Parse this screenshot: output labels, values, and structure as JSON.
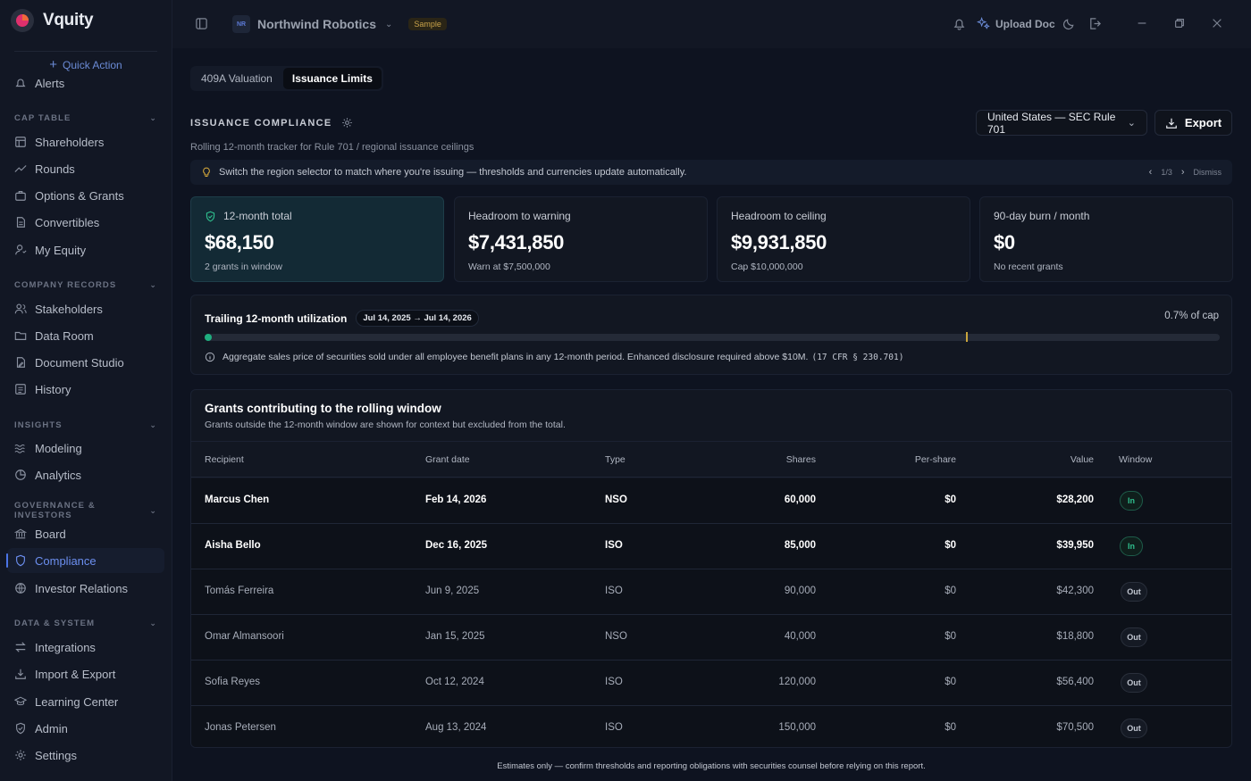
{
  "app": {
    "name": "Vquity",
    "quick_action": "Quick Action"
  },
  "sidebar": {
    "alerts_label": "Alerts",
    "sections": [
      {
        "title": "CAP TABLE",
        "items": [
          "Shareholders",
          "Rounds",
          "Options & Grants",
          "Convertibles",
          "My Equity"
        ]
      },
      {
        "title": "COMPANY RECORDS",
        "items": [
          "Stakeholders",
          "Data Room",
          "Document Studio",
          "History"
        ]
      },
      {
        "title": "INSIGHTS",
        "items": [
          "Modeling",
          "Analytics"
        ]
      },
      {
        "title": "GOVERNANCE & INVESTORS",
        "items": [
          "Board",
          "Compliance",
          "Investor Relations"
        ]
      },
      {
        "title": "DATA & SYSTEM",
        "items": [
          "Integrations",
          "Import & Export",
          "Learning Center",
          "Admin",
          "Settings"
        ]
      }
    ],
    "active_item": "Compliance"
  },
  "topbar": {
    "workspace_initials": "NR",
    "workspace_name": "Northwind Robotics",
    "sample_badge": "Sample",
    "upload_label": "Upload Doc"
  },
  "tabs": [
    {
      "label": "409A Valuation",
      "active": false
    },
    {
      "label": "Issuance Limits",
      "active": true
    }
  ],
  "compliance": {
    "title": "ISSUANCE COMPLIANCE",
    "subtitle": "Rolling 12-month tracker for Rule 701 / regional issuance ceilings",
    "region": "United States — SEC Rule 701",
    "export_label": "Export",
    "tip": "Switch the region selector to match where you're issuing — thresholds and currencies update automatically.",
    "tip_pager": "1/3",
    "tip_dismiss": "Dismiss"
  },
  "kpis": [
    {
      "label": "12-month total",
      "value": "$68,150",
      "sub": "2 grants in window"
    },
    {
      "label": "Headroom to warning",
      "value": "$7,431,850",
      "sub": "Warn at $7,500,000"
    },
    {
      "label": "Headroom to ceiling",
      "value": "$9,931,850",
      "sub": "Cap $10,000,000"
    },
    {
      "label": "90-day burn / month",
      "value": "$0",
      "sub": "No recent grants"
    }
  ],
  "utilization": {
    "title": "Trailing 12-month utilization",
    "range": "Jul 14, 2025 → Jul 14, 2026",
    "percent_label": "0.7% of cap",
    "fill_fraction": 0.007,
    "warn_fraction": 0.75,
    "note": "Aggregate sales price of securities sold under all employee benefit plans in any 12-month period. Enhanced disclosure required above $10M.",
    "citation": "(17 CFR § 230.701)",
    "colors": {
      "fill": "#1fae7f",
      "warn": "#c9a53c"
    }
  },
  "grants": {
    "title": "Grants contributing to the rolling window",
    "subtitle": "Grants outside the 12-month window are shown for context but excluded from the total.",
    "columns": [
      "Recipient",
      "Grant date",
      "Type",
      "Shares",
      "Per-share",
      "Value",
      "Window"
    ],
    "rows": [
      {
        "recipient": "Marcus Chen",
        "date": "Feb 14, 2026",
        "type": "NSO",
        "shares": "60,000",
        "per_share": "$0",
        "value": "$28,200",
        "window": "In"
      },
      {
        "recipient": "Aisha Bello",
        "date": "Dec 16, 2025",
        "type": "ISO",
        "shares": "85,000",
        "per_share": "$0",
        "value": "$39,950",
        "window": "In"
      },
      {
        "recipient": "Tomás Ferreira",
        "date": "Jun 9, 2025",
        "type": "ISO",
        "shares": "90,000",
        "per_share": "$0",
        "value": "$42,300",
        "window": "Out"
      },
      {
        "recipient": "Omar Almansoori",
        "date": "Jan 15, 2025",
        "type": "NSO",
        "shares": "40,000",
        "per_share": "$0",
        "value": "$18,800",
        "window": "Out"
      },
      {
        "recipient": "Sofia Reyes",
        "date": "Oct 12, 2024",
        "type": "ISO",
        "shares": "120,000",
        "per_share": "$0",
        "value": "$56,400",
        "window": "Out"
      },
      {
        "recipient": "Jonas Petersen",
        "date": "Aug 13, 2024",
        "type": "ISO",
        "shares": "150,000",
        "per_share": "$0",
        "value": "$70,500",
        "window": "Out"
      }
    ]
  },
  "footer": "Estimates only — confirm thresholds and reporting obligations with securities counsel before relying on this report."
}
